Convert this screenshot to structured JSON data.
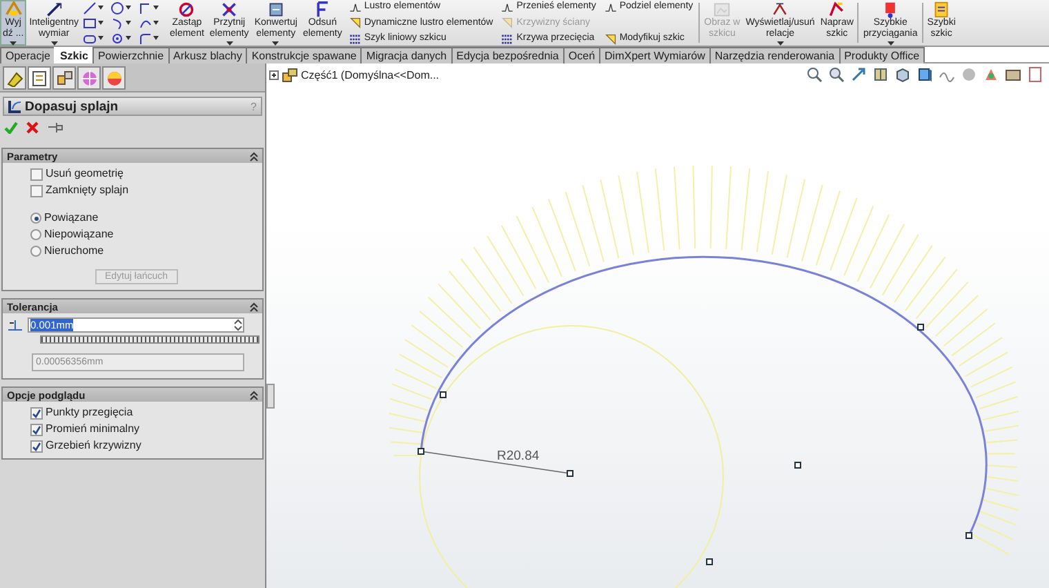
{
  "ribbon": {
    "columns": [
      {
        "kind": "large",
        "label": "Wyj\ndź ...",
        "pressed": true,
        "dropdown": true
      },
      {
        "kind": "large",
        "label": "Inteligentny\nwymiar",
        "pressed": false,
        "dropdown": true
      },
      {
        "kind": "icon_grid"
      },
      {
        "kind": "large",
        "label": "Zastąp\nelement",
        "pressed": false,
        "dropdown": false
      },
      {
        "kind": "large",
        "label": "Przytnij\nelementy",
        "pressed": false,
        "dropdown": true
      },
      {
        "kind": "large",
        "label": "Konwertuj\nelementy",
        "pressed": false,
        "dropdown": true
      },
      {
        "kind": "large",
        "label": "Odsuń\nelementy",
        "pressed": false,
        "dropdown": false
      },
      {
        "kind": "stack",
        "items": [
          {
            "label": "Lustro elementów",
            "disabled": false
          },
          {
            "label": "Dynamiczne lustro elementów",
            "disabled": false
          },
          {
            "label": "Szyk liniowy szkicu",
            "disabled": false
          }
        ]
      },
      {
        "kind": "stack",
        "items": [
          {
            "label": "Przenieś elementy",
            "disabled": false
          },
          {
            "label": "Krzywizny ściany",
            "disabled": true
          },
          {
            "label": "Krzywa przecięcia",
            "disabled": false
          }
        ]
      },
      {
        "kind": "stack",
        "items": [
          {
            "label": "Podziel elementy",
            "disabled": false
          },
          {
            "label": "Modyfikuj szkic",
            "disabled": false
          }
        ]
      },
      {
        "kind": "large",
        "label": "Obraz w\nszkicu",
        "pressed": false,
        "dropdown": false,
        "disabled": true
      },
      {
        "kind": "large",
        "label": "Wyświetlaj/usuń\nrelacje",
        "pressed": false,
        "dropdown": true
      },
      {
        "kind": "large",
        "label": "Napraw\nszkic",
        "pressed": false,
        "dropdown": false
      },
      {
        "kind": "large",
        "label": "Szybkie\nprzyciągania",
        "pressed": false,
        "dropdown": true
      },
      {
        "kind": "large",
        "label": "Szybki\nszkic",
        "pressed": false,
        "dropdown": false
      }
    ]
  },
  "tabs": [
    {
      "label": "Operacje",
      "selected": false
    },
    {
      "label": "Szkic",
      "selected": true
    },
    {
      "label": "Powierzchnie",
      "selected": false
    },
    {
      "label": "Arkusz blachy",
      "selected": false
    },
    {
      "label": "Konstrukcje spawane",
      "selected": false
    },
    {
      "label": "Migracja danych",
      "selected": false
    },
    {
      "label": "Edycja bezpośrednia",
      "selected": false
    },
    {
      "label": "Oceń",
      "selected": false
    },
    {
      "label": "DimXpert Wymiarów",
      "selected": false
    },
    {
      "label": "Narzędzia renderowania",
      "selected": false
    },
    {
      "label": "Produkty Office",
      "selected": false
    }
  ],
  "property_manager": {
    "title": "Dopasuj splajn",
    "help": "?",
    "sections": [
      {
        "title": "Parametry",
        "expanded": true,
        "controls": [
          {
            "kind": "checkbox",
            "label": "Usuń geometrię",
            "checked": false
          },
          {
            "kind": "checkbox",
            "label": "Zamknięty splajn",
            "checked": false
          },
          {
            "kind": "radio",
            "label": "Powiązane",
            "selected": true
          },
          {
            "kind": "radio",
            "label": "Niepowiązane",
            "selected": false
          },
          {
            "kind": "radio",
            "label": "Nieruchome",
            "selected": false
          },
          {
            "kind": "button",
            "label": "Edytuj łańcuch",
            "disabled": true
          }
        ]
      },
      {
        "title": "Tolerancja",
        "expanded": true,
        "controls": [
          {
            "kind": "spin",
            "value": "0.001mm",
            "level": 1
          },
          {
            "kind": "readout",
            "value": "0.00056356mm"
          }
        ]
      },
      {
        "title": "Opcje podglądu",
        "expanded": true,
        "controls": [
          {
            "kind": "checkbox",
            "label": "Punkty przegięcia",
            "checked": true
          },
          {
            "kind": "checkbox",
            "label": "Promień minimalny",
            "checked": true
          },
          {
            "kind": "checkbox",
            "label": "Grzebień krzywizny",
            "checked": true
          }
        ]
      }
    ]
  },
  "viewport": {
    "tree_item": "Część1  (Domyślna<<Dom...",
    "dimension": "R20.84"
  }
}
